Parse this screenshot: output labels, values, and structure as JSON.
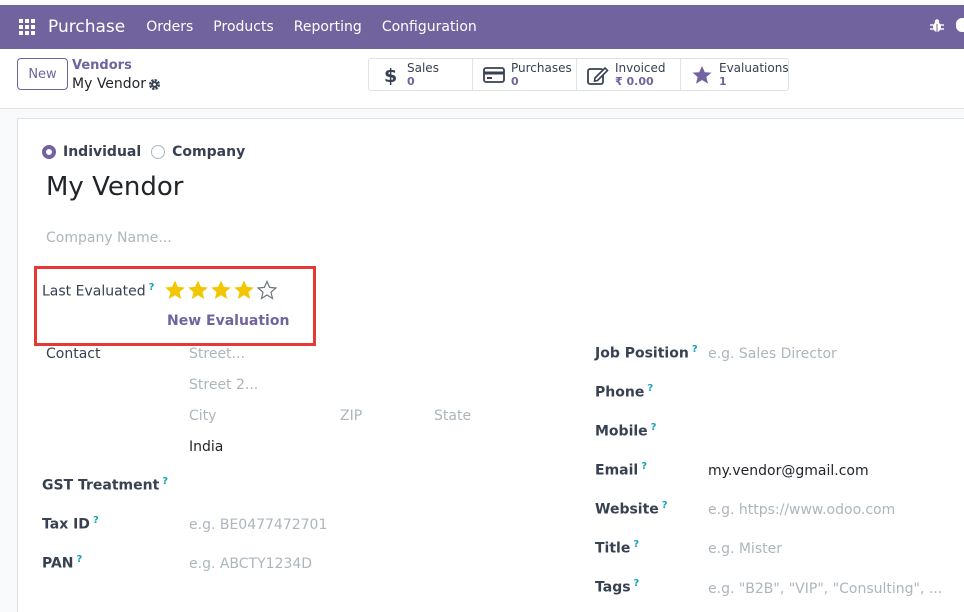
{
  "topbar": {
    "app_name": "Purchase",
    "menu": [
      "Orders",
      "Products",
      "Reporting",
      "Configuration"
    ],
    "color": "#71639e"
  },
  "control": {
    "new_label": "New",
    "breadcrumb_parent": "Vendors",
    "breadcrumb_current": "My Vendor"
  },
  "smart_buttons": [
    {
      "icon": "dollar-icon",
      "label": "Sales",
      "value": "0"
    },
    {
      "icon": "credit-card-icon",
      "label": "Purchases",
      "value": "0"
    },
    {
      "icon": "edit-icon",
      "label": "Invoiced",
      "value": "₹ 0.00"
    },
    {
      "icon": "star-icon",
      "label": "Evaluations",
      "value": "1"
    }
  ],
  "form": {
    "type_options": [
      "Individual",
      "Company"
    ],
    "type_selected": "Individual",
    "name": "My Vendor",
    "company_placeholder": "Company Name...",
    "last_evaluated_label": "Last Evaluated",
    "rating": 4,
    "rating_max": 5,
    "new_evaluation": "New Evaluation",
    "contact_label": "Contact",
    "street_placeholder": "Street...",
    "street2_placeholder": "Street 2...",
    "city_placeholder": "City",
    "zip_placeholder": "ZIP",
    "state_placeholder": "State",
    "country": "India",
    "gst_label": "GST Treatment",
    "taxid_label": "Tax ID",
    "taxid_placeholder": "e.g. BE0477472701",
    "pan_label": "PAN",
    "pan_placeholder": "e.g. ABCTY1234D",
    "job_label": "Job Position",
    "job_placeholder": "e.g. Sales Director",
    "phone_label": "Phone",
    "mobile_label": "Mobile",
    "email_label": "Email",
    "email_value": "my.vendor@gmail.com",
    "website_label": "Website",
    "website_placeholder": "e.g. https://www.odoo.com",
    "title_label": "Title",
    "title_placeholder": "e.g. Mister",
    "tags_label": "Tags",
    "tags_placeholder": "e.g. \"B2B\", \"VIP\", \"Consulting\", ...",
    "help_mark": "?"
  }
}
